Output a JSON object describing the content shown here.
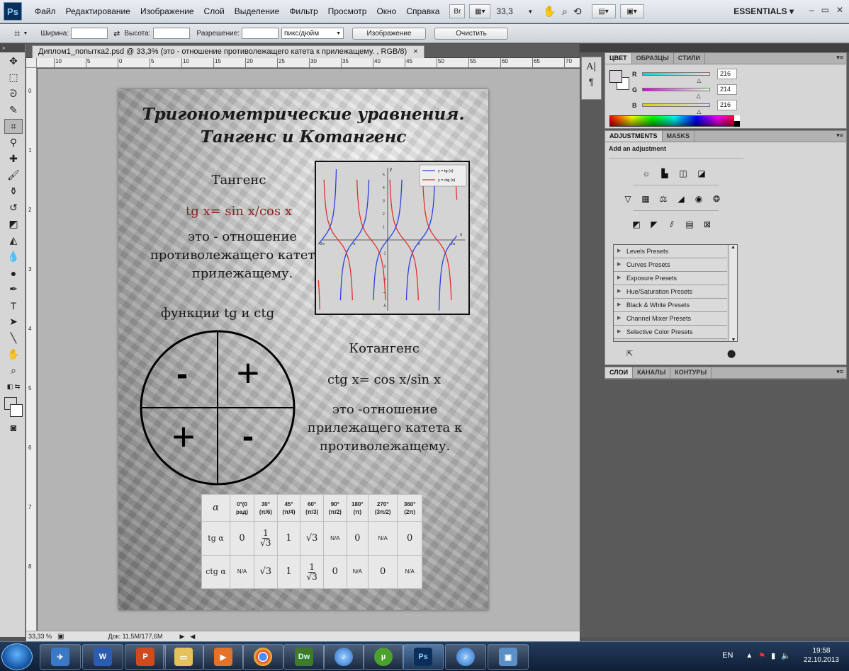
{
  "app": {
    "logo": "Ps"
  },
  "menu": [
    "Файл",
    "Редактирование",
    "Изображение",
    "Слой",
    "Выделение",
    "Фильтр",
    "Просмотр",
    "Окно",
    "Справка"
  ],
  "menubar": {
    "br_label": "Br",
    "zoom": "33,3",
    "workspace": "ESSENTIALS",
    "window_controls": [
      "–",
      "▭",
      "✕"
    ]
  },
  "options": {
    "width_label": "Ширина:",
    "height_label": "Высота:",
    "resolution_label": "Разрешение:",
    "width_value": "",
    "height_value": "",
    "resolution_value": "",
    "units": "пикс/дюйм",
    "image_button": "Изображение",
    "clear_button": "Очистить"
  },
  "document": {
    "tab_title": "Диплом1_попытка2.psd @ 33,3% (это - отношение противолежащего  катета к прилежащему. , RGB/8)",
    "close": "×",
    "ruler_top": [
      "10",
      "5",
      "0",
      "5",
      "10",
      "15",
      "20",
      "25",
      "30",
      "35",
      "40",
      "45",
      "50",
      "55",
      "60",
      "65",
      "70"
    ],
    "ruler_left": [
      "0",
      "1",
      "2",
      "3",
      "4",
      "5",
      "6",
      "7",
      "8"
    ]
  },
  "status": {
    "zoom": "33,33 %",
    "doc_info": "Док: 11,5M/177,6M"
  },
  "poster": {
    "title_line1": "Тригонометрические уравнения.",
    "title_line2": "Тангенс и Котангенс",
    "tan_heading": "Тангенс",
    "tan_formula": "tg x= sin x/cos x",
    "tan_description": "это - отношение противолежащего катета к прилежащему.",
    "functions_label": "функции tg и ctg",
    "cot_heading": "Котангенс",
    "cot_formula": "ctg x= cos x/sin x",
    "cot_description": "это -отношение прилежащего катета к противолежащему.",
    "quadrant_signs": [
      "-",
      "+",
      "+",
      "-"
    ],
    "graph_legend": [
      "y = tg (x)",
      "y = ctg (x)"
    ],
    "graph_y_ticks": [
      "5",
      "4",
      "3",
      "2",
      "1",
      "-1",
      "-2",
      "-3",
      "-4",
      "-5"
    ],
    "graph_x_ticks": [
      "-2π",
      "-π",
      "π",
      "2π"
    ],
    "graph_axis_labels": {
      "x": "x",
      "y": "y"
    },
    "table": {
      "corner": "α",
      "headers": [
        "0°(0 рад)",
        "30° (π/6)",
        "45° (π/4)",
        "60° (π/3)",
        "90° (π/2)",
        "180° (π)",
        "270° (3π/2)",
        "360° (2π)"
      ],
      "row_tg_label": "tg α",
      "row_ctg_label": "ctg α",
      "tg": {
        "v0": "0",
        "v30_num": "1",
        "v30_den": "√3",
        "v45": "1",
        "v60": "√3",
        "v90": "N/A",
        "v180": "0",
        "v270": "N/A",
        "v360": "0"
      },
      "ctg": {
        "v0": "N/A",
        "v30": "√3",
        "v45": "1",
        "v60_num": "1",
        "v60_den": "√3",
        "v90": "0",
        "v180": "N/A",
        "v270": "0",
        "v360": "N/A"
      }
    },
    "colors": {
      "tan_formula": "#8b1f1f",
      "tg_curve": "#2b3fe0",
      "ctg_curve": "#e0302b"
    }
  },
  "color_panel": {
    "tabs": [
      "ЦВЕТ",
      "ОБРАЗЦЫ",
      "СТИЛИ"
    ],
    "R": {
      "label": "R",
      "value": "216",
      "level": 0.847
    },
    "G": {
      "label": "G",
      "value": "214",
      "level": 0.839
    },
    "B": {
      "label": "B",
      "value": "216",
      "level": 0.847
    }
  },
  "adjustments_panel": {
    "tabs": [
      "ADJUSTMENTS",
      "MASKS"
    ],
    "title": "Add an adjustment",
    "presets": [
      "Levels Presets",
      "Curves Presets",
      "Exposure Presets",
      "Hue/Saturation Presets",
      "Black & White Presets",
      "Channel Mixer Presets",
      "Selective Color Presets"
    ]
  },
  "layers_panel": {
    "tabs": [
      "СЛОИ",
      "КАНАЛЫ",
      "КОНТУРЫ"
    ]
  },
  "taskbar": {
    "apps": [
      "Проводник",
      "Word",
      "PowerPoint",
      "Папка",
      "Media",
      "Chrome",
      "Dw",
      "iTunes",
      "uTorrent",
      "Ps",
      "iTunes 2",
      "Окно"
    ],
    "lang": "EN",
    "time": "19:58",
    "date": "22.10.2013"
  }
}
